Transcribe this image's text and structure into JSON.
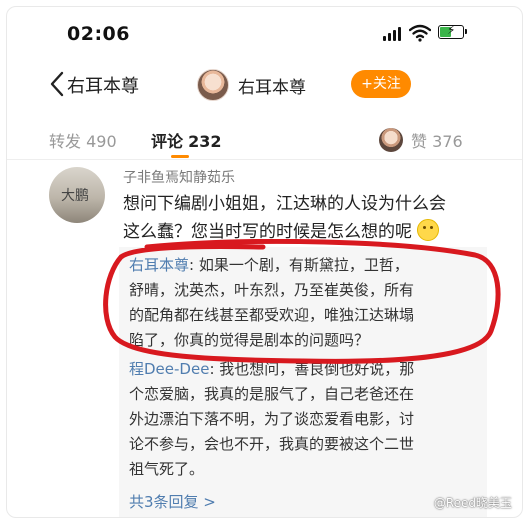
{
  "status_bar": {
    "time": "02:06"
  },
  "nav": {
    "back_label": "右耳本尊",
    "title": "右耳本尊",
    "follow_label": "+关注"
  },
  "tabs": {
    "repost_label": "转发",
    "repost_count": "490",
    "comment_label": "评论",
    "comment_count": "232",
    "like_label": "赞",
    "like_count": "376"
  },
  "comment": {
    "avatar_text": "大鹏",
    "username": "子非鱼焉知静茹乐",
    "lines": [
      "想问下编剧小姐姐，江达琳的人设为什么会",
      "这么蠢？您当时写的时候是怎么想的呢"
    ]
  },
  "replies": [
    {
      "author": "右耳本尊",
      "lines": [
        ": 如果一个剧，有斯黛拉，卫哲，",
        "舒晴，沈英杰，叶东烈，乃至崔英俊，所有",
        "的配角都在线甚至都受欢迎，唯独江达琳塌",
        "陷了，你真的觉得是剧本的问题吗？"
      ]
    },
    {
      "author": "程Dee-Dee",
      "lines": ": 我也想问，善良倒也好说，那|个恋爱脑，我真的是服气了，自己老爸还在|外边漂泊下落不明，为了谈恋爱看电影，讨|论不参与，会也不开，我真的要被这个二世|祖气死了。"
    }
  ],
  "more_replies": "共3条回复 >",
  "watermark": "@Reed晓美玉",
  "colors": {
    "accent": "#ff8a00",
    "link": "#507daf",
    "annotation": "#d8191f"
  }
}
